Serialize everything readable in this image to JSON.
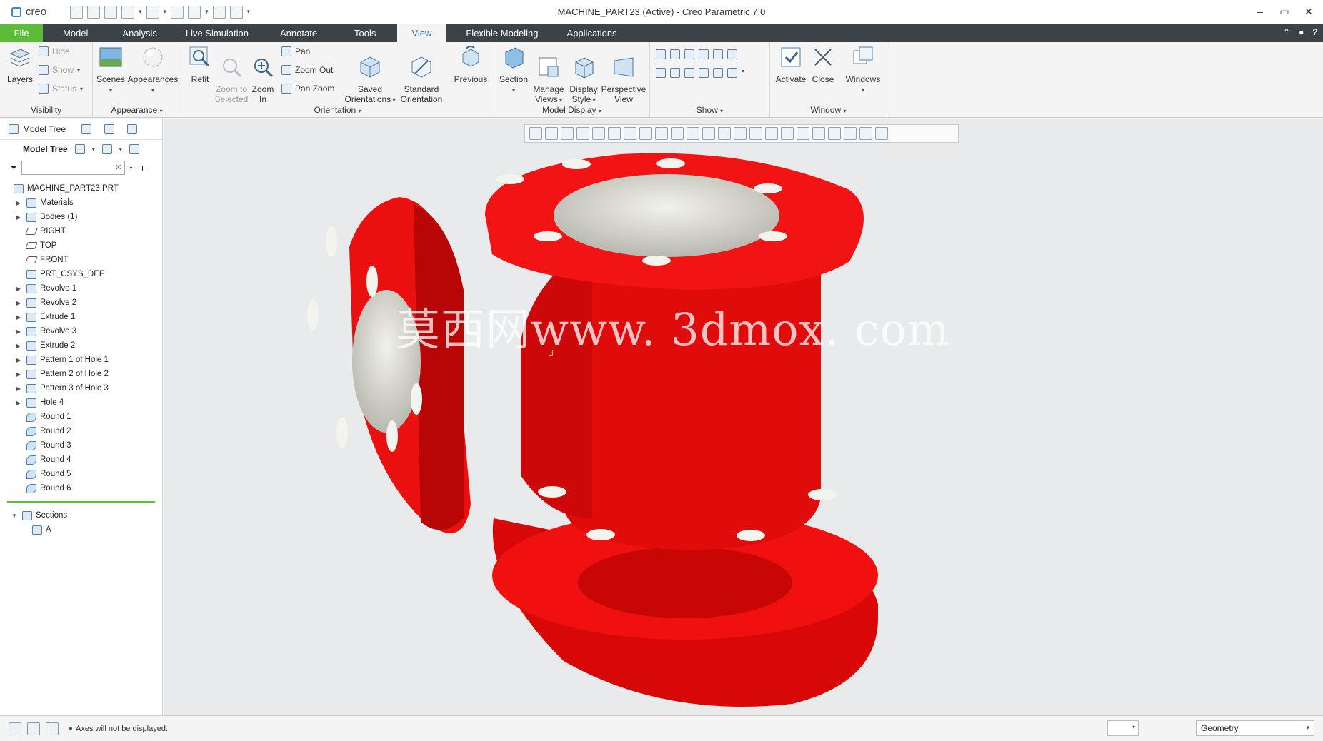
{
  "app": {
    "logo_text": "creo",
    "window_title": "MACHINE_PART23 (Active) - Creo Parametric 7.0"
  },
  "tabs": [
    "File",
    "Model",
    "Analysis",
    "Live Simulation",
    "Annotate",
    "Tools",
    "View",
    "Flexible Modeling",
    "Applications"
  ],
  "active_tab": "View",
  "ribbon": {
    "visibility": {
      "label": "Visibility",
      "layers": "Layers",
      "hide": "Hide",
      "show": "Show",
      "status": "Status"
    },
    "appearance": {
      "label": "Appearance",
      "scenes": "Scenes",
      "appearances": "Appearances"
    },
    "orientation": {
      "label": "Orientation",
      "refit": "Refit",
      "zoom_to_selected": "Zoom to\nSelected",
      "zoom_in": "Zoom\nIn",
      "pan": "Pan",
      "zoom_out": "Zoom Out",
      "pan_zoom": "Pan Zoom",
      "saved_orientations": "Saved\nOrientations",
      "standard_orientation": "Standard\nOrientation",
      "previous": "Previous"
    },
    "model_display": {
      "label": "Model Display",
      "section": "Section",
      "manage_views": "Manage\nViews",
      "display_style": "Display\nStyle",
      "perspective_view": "Perspective\nView"
    },
    "show": {
      "label": "Show"
    },
    "window": {
      "label": "Window",
      "activate": "Activate",
      "close": "Close",
      "windows": "Windows"
    }
  },
  "left_panel": {
    "tab_label": "Model Tree",
    "header": "Model Tree",
    "root": "MACHINE_PART23.PRT",
    "items": [
      {
        "label": "Materials",
        "expandable": true,
        "icon": "materials-icon"
      },
      {
        "label": "Bodies (1)",
        "expandable": true,
        "icon": "bodies-icon"
      },
      {
        "label": "RIGHT",
        "expandable": false,
        "icon": "datum-plane-icon"
      },
      {
        "label": "TOP",
        "expandable": false,
        "icon": "datum-plane-icon"
      },
      {
        "label": "FRONT",
        "expandable": false,
        "icon": "datum-plane-icon"
      },
      {
        "label": "PRT_CSYS_DEF",
        "expandable": false,
        "icon": "csys-icon"
      },
      {
        "label": "Revolve 1",
        "expandable": true,
        "icon": "revolve-icon"
      },
      {
        "label": "Revolve 2",
        "expandable": true,
        "icon": "revolve-icon"
      },
      {
        "label": "Extrude 1",
        "expandable": true,
        "icon": "extrude-icon"
      },
      {
        "label": "Revolve 3",
        "expandable": true,
        "icon": "revolve-icon"
      },
      {
        "label": "Extrude 2",
        "expandable": true,
        "icon": "extrude-icon"
      },
      {
        "label": "Pattern 1 of Hole 1",
        "expandable": true,
        "icon": "pattern-icon"
      },
      {
        "label": "Pattern 2 of Hole 2",
        "expandable": true,
        "icon": "pattern-icon"
      },
      {
        "label": "Pattern 3 of Hole 3",
        "expandable": true,
        "icon": "pattern-icon"
      },
      {
        "label": "Hole 4",
        "expandable": true,
        "icon": "hole-icon"
      },
      {
        "label": "Round 1",
        "expandable": false,
        "icon": "round-icon"
      },
      {
        "label": "Round 2",
        "expandable": false,
        "icon": "round-icon"
      },
      {
        "label": "Round 3",
        "expandable": false,
        "icon": "round-icon"
      },
      {
        "label": "Round 4",
        "expandable": false,
        "icon": "round-icon"
      },
      {
        "label": "Round 5",
        "expandable": false,
        "icon": "round-icon"
      },
      {
        "label": "Round 6",
        "expandable": false,
        "icon": "round-icon"
      }
    ],
    "sections_label": "Sections",
    "section_items": [
      "A"
    ]
  },
  "graphics": {
    "watermark": "莫西网www. 3dmox. com",
    "model_color": "#ee1111"
  },
  "status_bar": {
    "message": "Axes will not be displayed.",
    "filter_value": "Geometry"
  }
}
